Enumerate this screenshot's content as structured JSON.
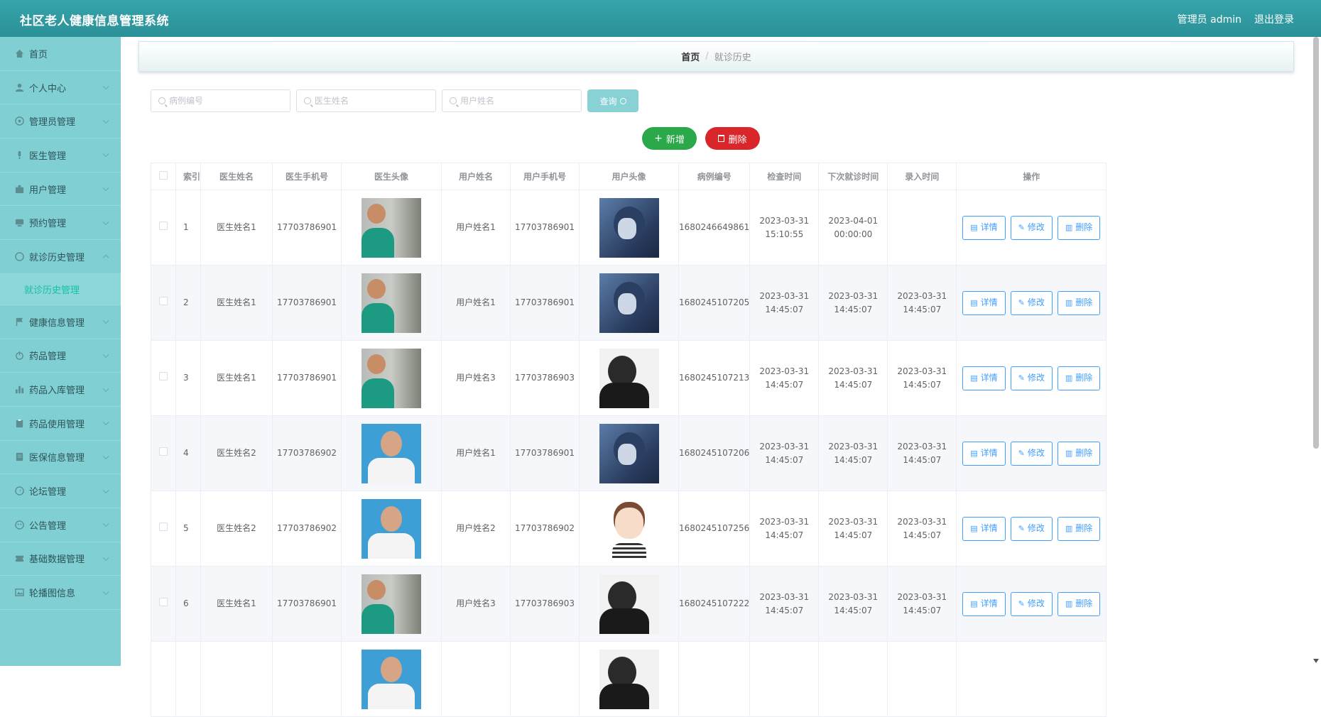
{
  "app": {
    "title": "社区老人健康信息管理系统",
    "user_label": "管理员 admin",
    "logout_label": "退出登录"
  },
  "sidebar": {
    "items": [
      {
        "label": "首页",
        "icon": "home-icon"
      },
      {
        "label": "个人中心",
        "icon": "user-icon"
      },
      {
        "label": "管理员管理",
        "icon": "globe-icon"
      },
      {
        "label": "医生管理",
        "icon": "mic-icon"
      },
      {
        "label": "用户管理",
        "icon": "briefcase-icon"
      },
      {
        "label": "预约管理",
        "icon": "monitor-icon"
      },
      {
        "label": "就诊历史管理",
        "icon": "compass-icon",
        "expanded": true
      },
      {
        "label": "健康信息管理",
        "icon": "flag-icon"
      },
      {
        "label": "药品管理",
        "icon": "power-icon"
      },
      {
        "label": "药品入库管理",
        "icon": "bar-chart-icon"
      },
      {
        "label": "药品使用管理",
        "icon": "clipboard-icon"
      },
      {
        "label": "医保信息管理",
        "icon": "document-icon"
      },
      {
        "label": "论坛管理",
        "icon": "dashboard-icon"
      },
      {
        "label": "公告管理",
        "icon": "smile-icon"
      },
      {
        "label": "基础数据管理",
        "icon": "ticket-icon"
      },
      {
        "label": "轮播图信息",
        "icon": "picture-icon"
      }
    ],
    "sub_item": "就诊历史管理"
  },
  "breadcrumb": {
    "home": "首页",
    "separator": "/",
    "current": "就诊历史"
  },
  "search": {
    "case_no_placeholder": "病例编号",
    "doctor_name_placeholder": "医生姓名",
    "user_name_placeholder": "用户姓名",
    "query_label": "查询"
  },
  "actions": {
    "add_label": "新增",
    "delete_label": "删除"
  },
  "table": {
    "headers": [
      "索引",
      "医生姓名",
      "医生手机号",
      "医生头像",
      "用户姓名",
      "用户手机号",
      "用户头像",
      "病例编号",
      "检查时间",
      "下次就诊时间",
      "录入时间",
      "操作"
    ],
    "op_labels": {
      "detail": "详情",
      "edit": "修改",
      "delete": "删除"
    },
    "rows": [
      {
        "index": "1",
        "doctor_name": "医生姓名1",
        "doctor_phone": "17703786901",
        "doctor_avatar": "doc1",
        "user_name": "用户姓名1",
        "user_phone": "17703786901",
        "user_avatar": "user1",
        "case_no": "1680246649861",
        "check_time": "2023-03-31 15:10:55",
        "next_time": "2023-04-01 00:00:00",
        "insert_time": ""
      },
      {
        "index": "2",
        "doctor_name": "医生姓名1",
        "doctor_phone": "17703786901",
        "doctor_avatar": "doc1",
        "user_name": "用户姓名1",
        "user_phone": "17703786901",
        "user_avatar": "user1",
        "case_no": "1680245107205",
        "check_time": "2023-03-31 14:45:07",
        "next_time": "2023-03-31 14:45:07",
        "insert_time": "2023-03-31 14:45:07"
      },
      {
        "index": "3",
        "doctor_name": "医生姓名1",
        "doctor_phone": "17703786901",
        "doctor_avatar": "doc1",
        "user_name": "用户姓名3",
        "user_phone": "17703786903",
        "user_avatar": "user3",
        "case_no": "1680245107213",
        "check_time": "2023-03-31 14:45:07",
        "next_time": "2023-03-31 14:45:07",
        "insert_time": "2023-03-31 14:45:07"
      },
      {
        "index": "4",
        "doctor_name": "医生姓名2",
        "doctor_phone": "17703786902",
        "doctor_avatar": "doc2",
        "user_name": "用户姓名1",
        "user_phone": "17703786901",
        "user_avatar": "user1",
        "case_no": "1680245107206",
        "check_time": "2023-03-31 14:45:07",
        "next_time": "2023-03-31 14:45:07",
        "insert_time": "2023-03-31 14:45:07"
      },
      {
        "index": "5",
        "doctor_name": "医生姓名2",
        "doctor_phone": "17703786902",
        "doctor_avatar": "doc2",
        "user_name": "用户姓名2",
        "user_phone": "17703786902",
        "user_avatar": "user2",
        "case_no": "1680245107256",
        "check_time": "2023-03-31 14:45:07",
        "next_time": "2023-03-31 14:45:07",
        "insert_time": "2023-03-31 14:45:07"
      },
      {
        "index": "6",
        "doctor_name": "医生姓名1",
        "doctor_phone": "17703786901",
        "doctor_avatar": "doc1",
        "user_name": "用户姓名3",
        "user_phone": "17703786903",
        "user_avatar": "user3",
        "case_no": "1680245107222",
        "check_time": "2023-03-31 14:45:07",
        "next_time": "2023-03-31 14:45:07",
        "insert_time": "2023-03-31 14:45:07"
      },
      {
        "index": "",
        "doctor_name": "",
        "doctor_phone": "",
        "doctor_avatar": "doc2",
        "user_name": "",
        "user_phone": "",
        "user_avatar": "user3",
        "case_no": "",
        "check_time": "",
        "next_time": "",
        "insert_time": ""
      }
    ]
  },
  "colors": {
    "header": "#2b9198",
    "sidebar": "#7fcfd3",
    "active_sub": "#13c2a4",
    "add": "#2aa84a",
    "delete": "#d9262b",
    "op": "#409eff"
  }
}
